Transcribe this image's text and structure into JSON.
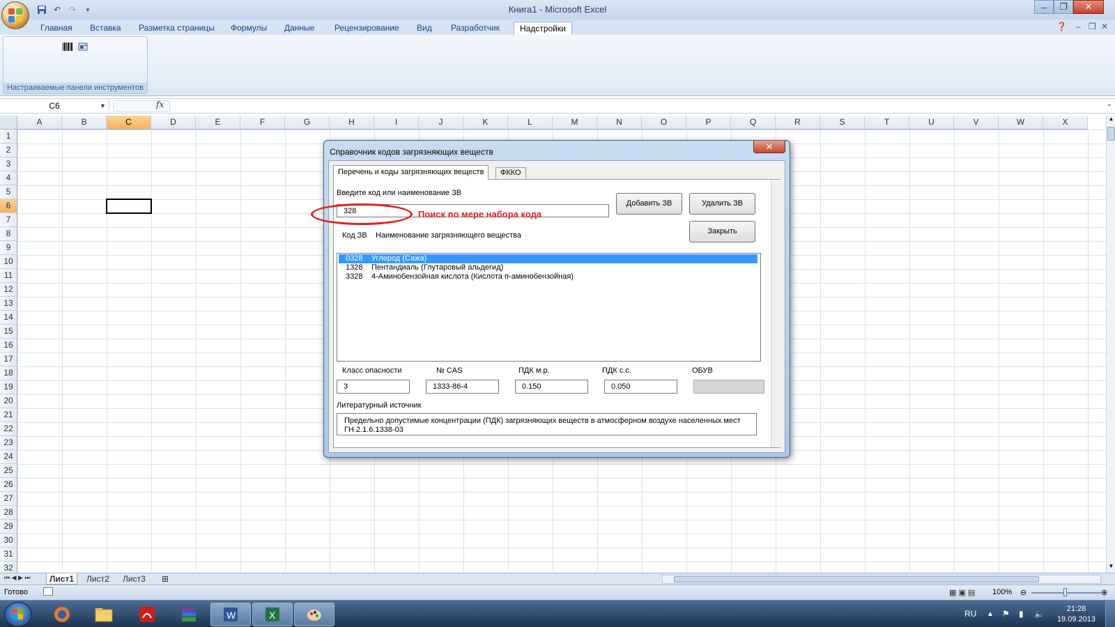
{
  "window": {
    "title": "Книга1 - Microsoft Excel"
  },
  "ribbon": {
    "tabs": [
      "Главная",
      "Вставка",
      "Разметка страницы",
      "Формулы",
      "Данные",
      "Рецензирование",
      "Вид",
      "Разработчик",
      "Надстройки"
    ],
    "active_tab": "Надстройки",
    "group_label": "Настраиваемые панели инструментов"
  },
  "formula_bar": {
    "name_box": "C6",
    "fx": "fx",
    "content": ""
  },
  "grid": {
    "columns": [
      "A",
      "B",
      "C",
      "D",
      "E",
      "F",
      "G",
      "H",
      "I",
      "J",
      "K",
      "L",
      "M",
      "N",
      "O",
      "P",
      "Q",
      "R",
      "S",
      "T",
      "U",
      "V",
      "W",
      "X"
    ],
    "rows": [
      "1",
      "2",
      "3",
      "4",
      "5",
      "6",
      "7",
      "8",
      "9",
      "10",
      "11",
      "12",
      "13",
      "14",
      "15",
      "16",
      "17",
      "18",
      "19",
      "20",
      "21",
      "22",
      "23",
      "24",
      "25",
      "26",
      "27",
      "28",
      "29",
      "30",
      "31",
      "32"
    ],
    "selected_column": "C",
    "selected_row": "6"
  },
  "sheets": {
    "tabs": [
      "Лист1",
      "Лист2",
      "Лист3"
    ],
    "active": "Лист1"
  },
  "status": {
    "text": "Готово",
    "zoom": "100%"
  },
  "taskbar": {
    "lang": "RU",
    "time": "21:28",
    "date": "19.09.2013"
  },
  "dialog": {
    "title": "Справочник кодов загрязняющих веществ",
    "close_symbol": "✕",
    "tabs": [
      "Перечень и коды загрязняющих веществ",
      "ФККО"
    ],
    "active_tab": "Перечень и коды загрязняющих веществ",
    "search_label": "Введите код или наименование ЗВ",
    "search_value": "328",
    "add_button": "Добавить ЗВ",
    "delete_button": "Удалить ЗВ",
    "close_button": "Закрыть",
    "list_header_code": "Код ЗВ",
    "list_header_name": "Наименование загрязняющего вещества",
    "list_items": [
      {
        "code": "0328",
        "name": "Углерод (Сажа)",
        "selected": true
      },
      {
        "code": "1328",
        "name": "Пентандиаль (Глутаровый альдегид)",
        "selected": false
      },
      {
        "code": "3328",
        "name": "4-Аминобензойная кислота (Кислота п-аминобензойная)",
        "selected": false
      }
    ],
    "fields": {
      "hazard_class_label": "Класс опасности",
      "hazard_class_value": "3",
      "cas_label": "№ CAS",
      "cas_value": "1333-86-4",
      "pdk_mr_label": "ПДК м.р.",
      "pdk_mr_value": "0.150",
      "pdk_ss_label": "ПДК с.с.",
      "pdk_ss_value": "0.050",
      "obuv_label": "ОБУВ",
      "obuv_value": ""
    },
    "source_label": "Литературный источник",
    "source_text": "Предельно допустимые концентрации (ПДК) загрязняющих веществ в атмосферном воздухе населенных мест ГН 2.1.6.1338-03"
  },
  "annotation": {
    "text": "Поиск по мере набора кода",
    "color": "#e02020"
  },
  "colors": {
    "selection_blue": "#3399ff",
    "header_highlight": "#f5b05a",
    "ribbon_blue": "#15428b"
  }
}
